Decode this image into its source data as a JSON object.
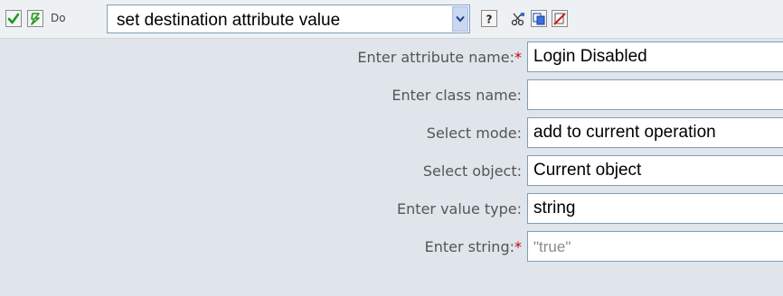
{
  "toolbar": {
    "do_label": "Do",
    "action": "set destination attribute value",
    "icons": [
      "enable-checkmark-icon",
      "conditional-lightning-icon",
      "help-icon",
      "cut-icon",
      "copy-icon",
      "delete-icon"
    ]
  },
  "fields": [
    {
      "label": "Enter attribute name:",
      "required": "*",
      "value": "Login Disabled",
      "placeholder": ""
    },
    {
      "label": "Enter class name:",
      "required": "",
      "value": "",
      "placeholder": ""
    },
    {
      "label": "Select mode:",
      "required": "",
      "value": "add to current operation",
      "placeholder": ""
    },
    {
      "label": "Select object:",
      "required": "",
      "value": "Current object",
      "placeholder": ""
    },
    {
      "label": "Enter value type:",
      "required": "",
      "value": "string",
      "placeholder": ""
    },
    {
      "label": "Enter string:",
      "required": "*",
      "value": "",
      "placeholder": "\"true\""
    }
  ],
  "colors": {
    "background": "#dfe5ea",
    "input_border": "#7f9db9",
    "required": "#cc0000"
  }
}
